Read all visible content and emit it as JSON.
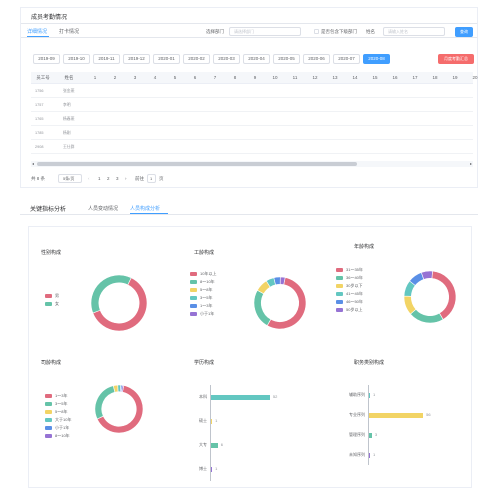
{
  "attendance": {
    "title": "成员考勤情况",
    "tabs": [
      "详细情况",
      "打卡情况"
    ],
    "filters": {
      "dept_label": "选择部门",
      "dept_placeholder": "请选择部门",
      "include_sub_label": "是否包含下级部门",
      "name_label": "姓名",
      "name_placeholder": "请输入姓名",
      "search_label": "查询"
    },
    "months": [
      "2019-09",
      "2019-10",
      "2019-11",
      "2019-12",
      "2020-01",
      "2020-02",
      "2020-03",
      "2020-04",
      "2020-05",
      "2020-06",
      "2020-07",
      "2020-08"
    ],
    "active_month": "2020-08",
    "export_label": "月度考勤汇总",
    "columns": [
      "员工号",
      "姓名",
      "1",
      "2",
      "3",
      "4",
      "5",
      "6",
      "7",
      "8",
      "9",
      "10",
      "11",
      "12",
      "13",
      "14",
      "15",
      "16",
      "17",
      "18",
      "19",
      "20"
    ],
    "rows": [
      {
        "id": "1756",
        "name": "张金燕"
      },
      {
        "id": "1757",
        "name": "李明"
      },
      {
        "id": "1765",
        "name": "杨春燕"
      },
      {
        "id": "1785",
        "name": "杨刚"
      },
      {
        "id": "2908",
        "name": "王仕群"
      }
    ],
    "pager": {
      "total": "共 8 条",
      "page_size": "5条/页",
      "pages": [
        "1",
        "2",
        "3"
      ],
      "current": "1",
      "goto_label": "前往",
      "goto_value": "1",
      "page_unit": "页"
    }
  },
  "analysis": {
    "title": "关键指标分析",
    "tabs": [
      "人员变动情况",
      "人员构成分析"
    ],
    "active_tab": "人员构成分析"
  },
  "colors": {
    "red": "#e06b7e",
    "green": "#65c3a8",
    "yellow": "#f2d465",
    "teal": "#63c7c1",
    "blue": "#5a8fe6",
    "purple": "#9673d4",
    "primary": "#409eff",
    "danger": "#f56c6c"
  },
  "chart_data": [
    {
      "type": "pie",
      "title": "性别构成",
      "labels": [
        "男",
        "女"
      ],
      "values": [
        62,
        38
      ],
      "colors": [
        "#e06b7e",
        "#65c3a8"
      ]
    },
    {
      "type": "pie",
      "title": "工龄构成",
      "labels": [
        "10年以上",
        "8～10年",
        "5～8年",
        "3～5年",
        "1～3年",
        "小于1年"
      ],
      "values": [
        55,
        25,
        8,
        5,
        4,
        3
      ],
      "colors": [
        "#e06b7e",
        "#65c3a8",
        "#f2d465",
        "#63c7c1",
        "#5a8fe6",
        "#9673d4"
      ]
    },
    {
      "type": "pie",
      "title": "年龄构成",
      "labels": [
        "31～35年",
        "36～40年",
        "30岁以下",
        "41～45年",
        "46～50年",
        "50岁以上"
      ],
      "values": [
        40,
        22,
        12,
        10,
        9,
        7
      ],
      "colors": [
        "#e06b7e",
        "#65c3a8",
        "#f2d465",
        "#63c7c1",
        "#5a8fe6",
        "#9673d4"
      ]
    },
    {
      "type": "pie",
      "title": "司龄构成",
      "labels": [
        "1～3年",
        "3～5年",
        "5～8年",
        "大于10年",
        "小于1年",
        "8～10年"
      ],
      "values": [
        65,
        28,
        3,
        2,
        1,
        1
      ],
      "colors": [
        "#e06b7e",
        "#65c3a8",
        "#f2d465",
        "#63c7c1",
        "#5a8fe6",
        "#9673d4"
      ]
    },
    {
      "type": "bar",
      "orientation": "horizontal",
      "title": "学历构成",
      "categories": [
        "本科",
        "硕士",
        "大专",
        "博士"
      ],
      "values": [
        52,
        1,
        6,
        1
      ],
      "colors": [
        "#63c7c1",
        "#f2d465",
        "#65c3a8",
        "#9673d4"
      ],
      "xlim": [
        0,
        60
      ]
    },
    {
      "type": "bar",
      "orientation": "horizontal",
      "title": "职务类别构成",
      "categories": [
        "辅助序列",
        "专业序列",
        "管理序列",
        "未知序列"
      ],
      "values": [
        1,
        56,
        3,
        1
      ],
      "colors": [
        "#63c7c1",
        "#f2d465",
        "#65c3a8",
        "#9673d4"
      ],
      "xlim": [
        0,
        60
      ]
    }
  ]
}
